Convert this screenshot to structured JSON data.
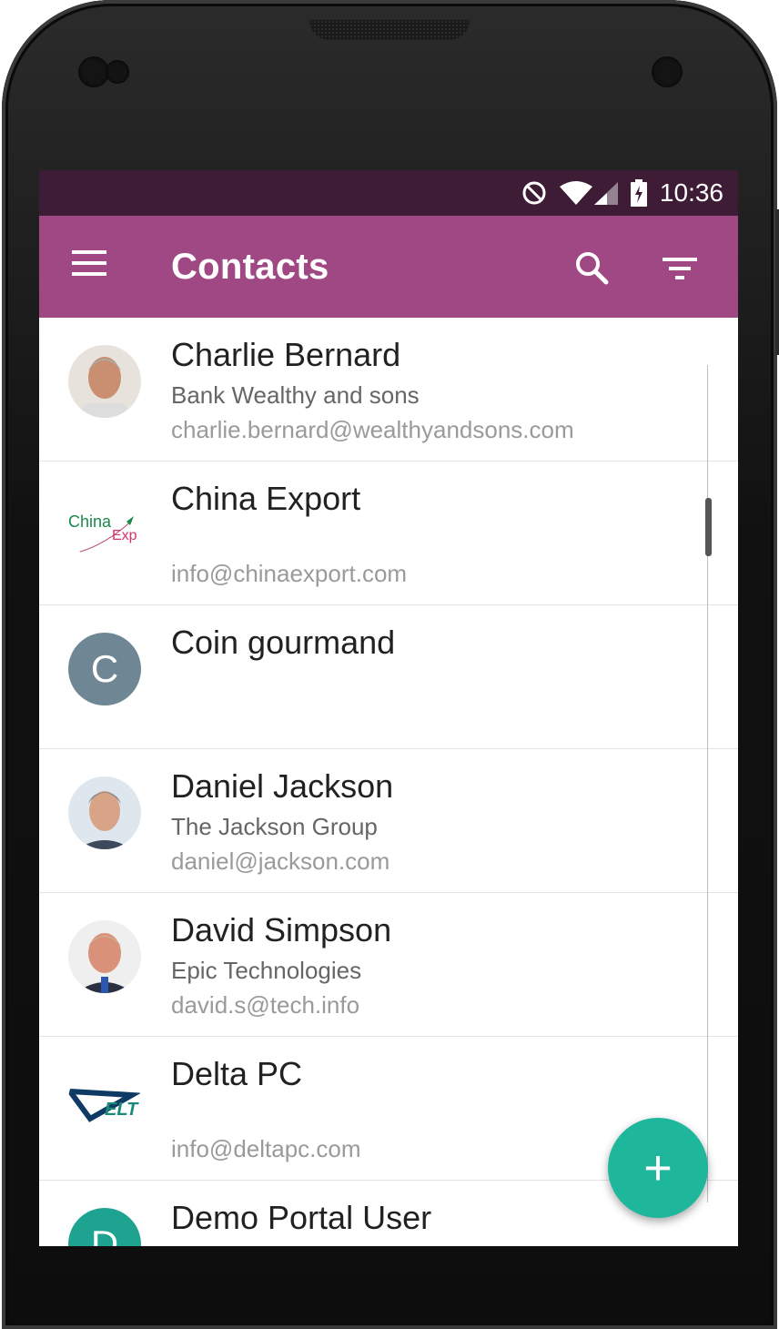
{
  "status_bar": {
    "time": "10:36"
  },
  "app_bar": {
    "title": "Contacts"
  },
  "contacts": [
    {
      "name": "Charlie Bernard",
      "company": "Bank Wealthy and sons",
      "email": "charlie.bernard@wealthyandsons.com",
      "avatar": "photo"
    },
    {
      "name": "China Export",
      "company": "",
      "email": "info@chinaexport.com",
      "avatar": "logo",
      "logo_text": "China Exp"
    },
    {
      "name": "Coin gourmand",
      "company": "",
      "email": "",
      "avatar": "letter",
      "initial": "C"
    },
    {
      "name": "Daniel Jackson",
      "company": "The Jackson Group",
      "email": "daniel@jackson.com",
      "avatar": "photo"
    },
    {
      "name": "David Simpson",
      "company": "Epic Technologies",
      "email": "david.s@tech.info",
      "avatar": "photo"
    },
    {
      "name": "Delta PC",
      "company": "",
      "email": "info@deltapc.com",
      "avatar": "logo",
      "logo_text": "ELT"
    },
    {
      "name": "Demo Portal User",
      "company": "",
      "email": "",
      "avatar": "letter",
      "initial": "D"
    }
  ],
  "fab": {
    "label": "+"
  },
  "colors": {
    "app_bar": "#a04883",
    "status_bar": "#3f1c36",
    "fab": "#1fb79b",
    "avatar_letter": "#6f8794"
  }
}
